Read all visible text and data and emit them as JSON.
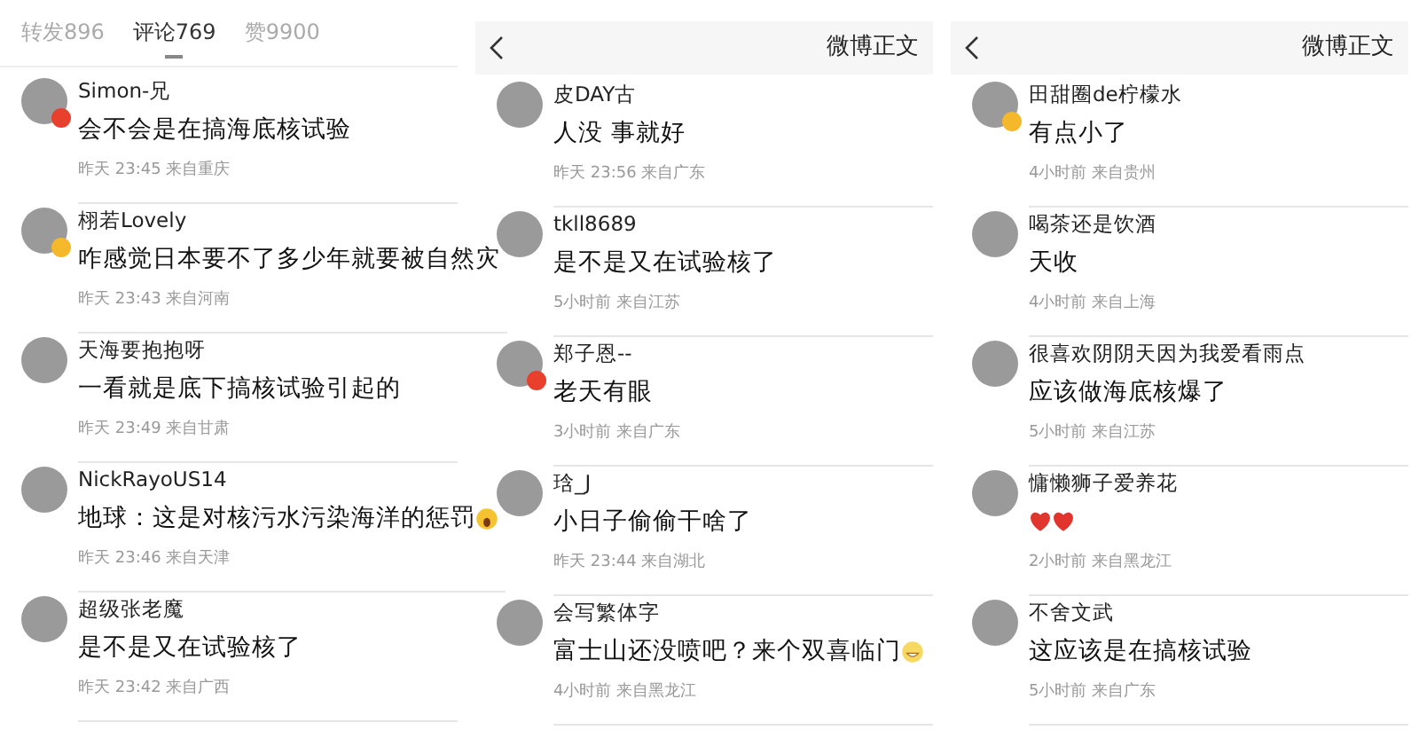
{
  "panels": [
    {
      "kind": "tabs",
      "tabs": [
        {
          "label": "转发896",
          "selected": false
        },
        {
          "label": "评论769",
          "selected": true
        },
        {
          "label": "赞9900",
          "selected": false
        }
      ],
      "comments": [
        {
          "user": "Simon-兄",
          "badge": {
            "color": "#e8402c"
          },
          "text": "会不会是在搞海底核试验",
          "meta": "昨天 23:45 来自重庆"
        },
        {
          "user": "栩若Lovely",
          "badge": {
            "color": "#f4b82a"
          },
          "text": "咋感觉日本要不了多少年就要被自然灾",
          "meta": "昨天 23:43 来自河南"
        },
        {
          "user": "天海要抱抱呀",
          "text": "一看就是底下搞核试验引起的",
          "meta": "昨天 23:49 来自甘肃"
        },
        {
          "user": "NickRayoUS14",
          "text": "地球：这是对核污水污染海洋的惩罚",
          "emoji": [
            {
              "kind": "face"
            }
          ],
          "meta": "昨天 23:46 来自天津"
        },
        {
          "user": "超级张老魔",
          "text": "是不是又在试验核了",
          "meta": "昨天 23:42 来自广西"
        }
      ]
    },
    {
      "kind": "header",
      "title": "微博正文",
      "comments": [
        {
          "user": "皮DAY古",
          "text": "人没 事就好",
          "meta": "昨天 23:56 来自广东"
        },
        {
          "user": "tkll8689",
          "text": "是不是又在试验核了",
          "meta": "5小时前 来自江苏"
        },
        {
          "user": "郑子恩--",
          "badge": {
            "color": "#e8402c"
          },
          "text": "老天有眼",
          "meta": "3小时前 来自广东"
        },
        {
          "user": "琀_J",
          "text": "小日子偷偷干啥了",
          "meta": "昨天 23:44 来自湖北"
        },
        {
          "user": "会写繁体字",
          "text": "富士山还没喷吧？来个双喜临门",
          "emoji": [
            {
              "kind": "grin"
            }
          ],
          "meta": "4小时前 来自黑龙江"
        }
      ]
    },
    {
      "kind": "header",
      "title": "微博正文",
      "comments": [
        {
          "user": "田甜圈de柠檬水",
          "badge": {
            "color": "#f4b82a"
          },
          "text": "有点小了",
          "meta": "4小时前 来自贵州"
        },
        {
          "user": "喝茶还是饮酒",
          "text": "天收",
          "meta": "4小时前 来自上海"
        },
        {
          "user": "很喜欢阴阴天因为我爱看雨点",
          "text": "应该做海底核爆了",
          "meta": "5小时前 来自江苏"
        },
        {
          "user": "慵懒狮子爱养花",
          "emoji": [
            {
              "kind": "heart"
            },
            {
              "kind": "heart"
            }
          ],
          "meta": "2小时前 来自黑龙江"
        },
        {
          "user": "不舍文武",
          "text": "这应该是在搞核试验",
          "meta": "5小时前 来自广东"
        }
      ]
    }
  ]
}
